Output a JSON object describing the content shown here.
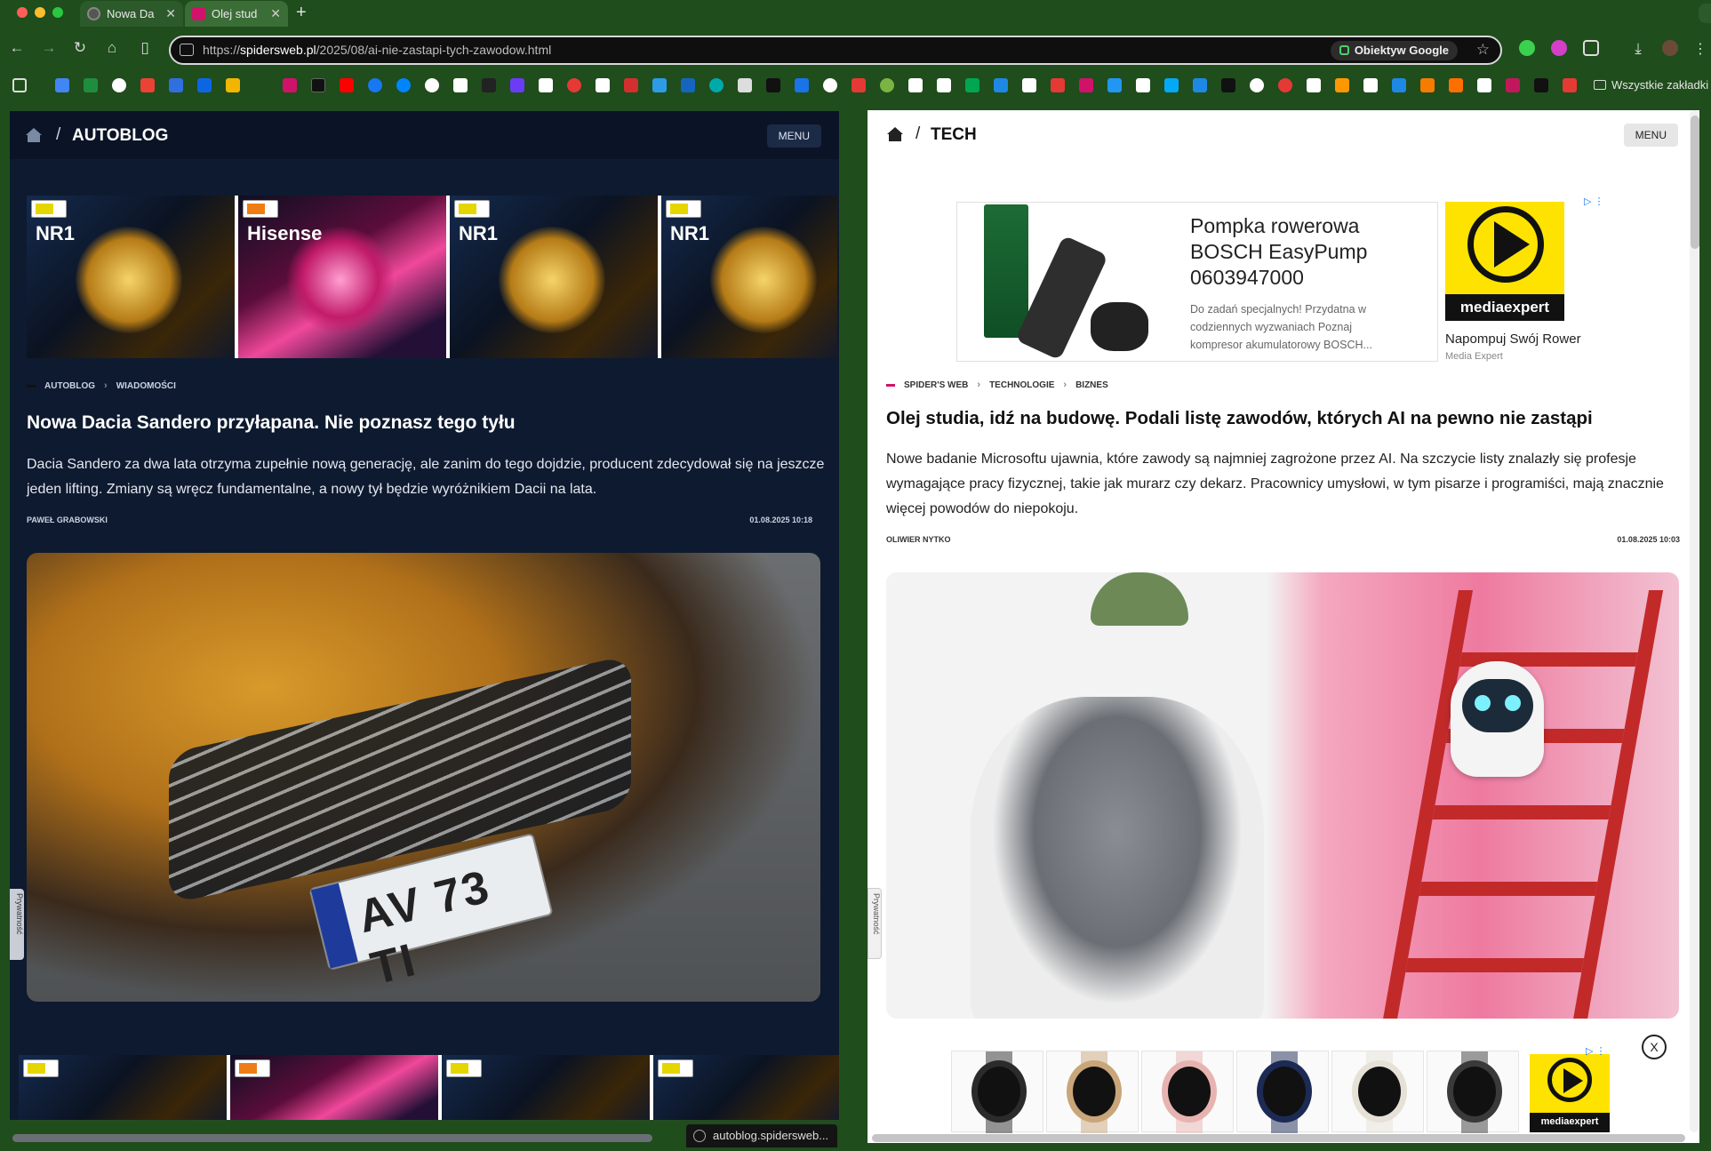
{
  "browser": {
    "tabs": [
      {
        "label": "Nowa Da",
        "active": false
      },
      {
        "label": "Olej stud",
        "active": true
      }
    ],
    "url_prefix": "https://",
    "url_host": "spidersweb.pl",
    "url_path": "/2025/08/ai-nie-zastapi-tych-zawodow.html",
    "lens_label": "Obiektyw Google",
    "bookmarks_folder": "Wszystkie zakładki",
    "status_url": "autoblog.spidersweb...",
    "nav_icons": [
      "back-icon",
      "forward-icon",
      "reload-icon",
      "home-icon",
      "side-panel-icon"
    ],
    "toolbar_icons": [
      "extension-green-icon",
      "download-pink-icon",
      "extensions-puzzle-icon",
      "downloads-icon",
      "profile-avatar",
      "kebab-menu-icon"
    ]
  },
  "left": {
    "section": "AUTOBLOG",
    "menu_label": "MENU",
    "crumbs": [
      "AUTOBLOG",
      "WIADOMOŚCI"
    ],
    "title": "Nowa Dacia Sandero przyłapana. Nie poznasz tego tyłu",
    "lead": "Dacia Sandero za dwa lata otrzyma zupełnie nową generację, ale zanim do tego dojdzie, producent zdecydował się na jeszcze jeden lifting. Zmiany są wręcz fundamentalne, a nowy tył będzie wyróżnikiem Dacii na lata.",
    "author": "PAWEŁ GRABOWSKI",
    "date": "01.08.2025 10:18",
    "plate_text": "AV 73 TI",
    "ad_brands": [
      "NR1",
      "Hisense",
      "NR1",
      "NR1"
    ],
    "privacy_label": "Prywatność"
  },
  "right": {
    "section": "TECH",
    "menu_label": "MENU",
    "crumbs": [
      "SPIDER'S WEB",
      "TECHNOLOGIE",
      "BIZNES"
    ],
    "title": "Olej studia, idź na budowę. Podali listę zawodów, których AI na pewno nie zastąpi",
    "lead": "Nowe badanie Microsoftu ujawnia, które zawody są najmniej zagrożone przez AI. Na szczycie listy znalazły się profesje wymagające pracy fizycznej, takie jak murarz czy dekarz. Pracownicy umysłowi, w tym pisarze i programiści, mają znacznie więcej powodów do niepokoju.",
    "author": "OLIWIER NYTKO",
    "date": "01.08.2025 10:03",
    "ad": {
      "title": "Pompka rowerowa BOSCH EasyPump 0603947000",
      "desc": "Do zadań specjalnych! Przydatna w codziennych wyzwaniach Poznaj kompresor akumulatorowy BOSCH...",
      "side_title": "Napompuj Swój Rower",
      "side_sub": "Media Expert",
      "logo_text": "mediaexpert"
    },
    "close_label": "X",
    "privacy_label": "Prywatność"
  },
  "colors": {
    "frame": "#1f4d1c",
    "left_bg": "#0e1a2f",
    "accent_pink": "#d1126b"
  }
}
